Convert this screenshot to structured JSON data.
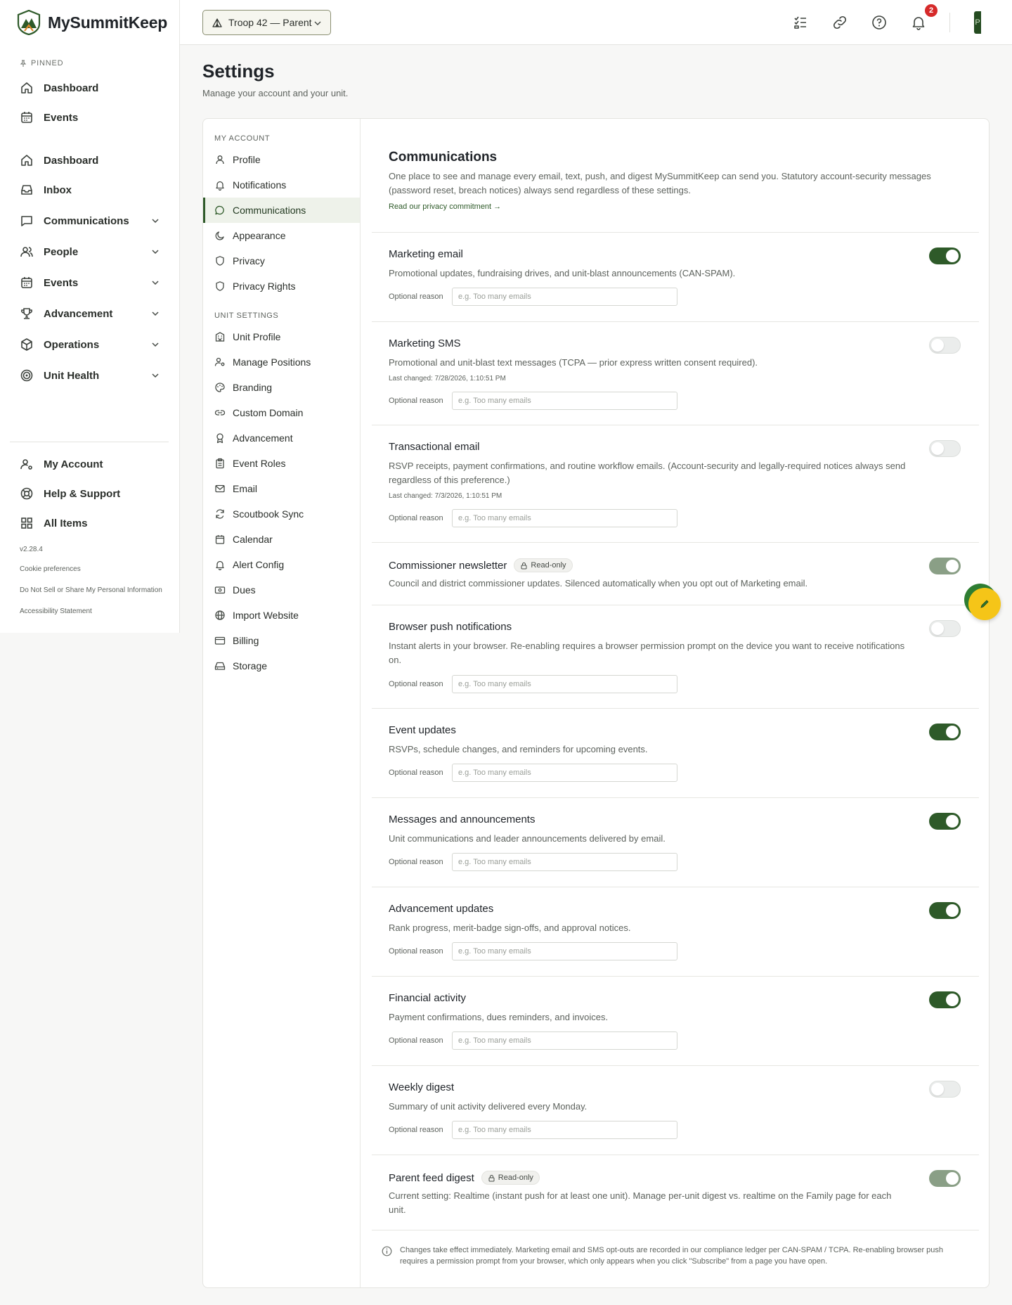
{
  "app": {
    "name": "MySummitKeep",
    "version": "v2.28.4"
  },
  "sidebar": {
    "pinned_label": "PINNED",
    "pinned": [
      {
        "label": "Dashboard"
      },
      {
        "label": "Events"
      }
    ],
    "items": [
      {
        "label": "Dashboard"
      },
      {
        "label": "Inbox"
      },
      {
        "label": "Communications"
      },
      {
        "label": "People"
      },
      {
        "label": "Events"
      },
      {
        "label": "Advancement"
      },
      {
        "label": "Operations"
      },
      {
        "label": "Unit Health"
      }
    ],
    "bottom": [
      {
        "label": "My Account"
      },
      {
        "label": "Help & Support"
      },
      {
        "label": "All Items"
      }
    ],
    "links": {
      "cookie": "Cookie preferences",
      "dns": "Do Not Sell or Share My Personal Information",
      "a11y": "Accessibility Statement"
    }
  },
  "topbar": {
    "unit_selector": "Troop 42 — Parent",
    "notification_count": "2",
    "avatar_initial": "P"
  },
  "page": {
    "title": "Settings",
    "subtitle": "Manage your account and your unit."
  },
  "settings_nav": {
    "my_account_label": "MY ACCOUNT",
    "my_account": [
      {
        "label": "Profile"
      },
      {
        "label": "Notifications"
      },
      {
        "label": "Communications"
      },
      {
        "label": "Appearance"
      },
      {
        "label": "Privacy"
      },
      {
        "label": "Privacy Rights"
      }
    ],
    "unit_settings_label": "UNIT SETTINGS",
    "unit_settings": [
      {
        "label": "Unit Profile"
      },
      {
        "label": "Manage Positions"
      },
      {
        "label": "Branding"
      },
      {
        "label": "Custom Domain"
      },
      {
        "label": "Advancement"
      },
      {
        "label": "Event Roles"
      },
      {
        "label": "Email"
      },
      {
        "label": "Scoutbook Sync"
      },
      {
        "label": "Calendar"
      },
      {
        "label": "Alert Config"
      },
      {
        "label": "Dues"
      },
      {
        "label": "Import Website"
      },
      {
        "label": "Billing"
      },
      {
        "label": "Storage"
      }
    ]
  },
  "communications": {
    "title": "Communications",
    "description": "One place to see and manage every email, text, push, and digest MySummitKeep can send you. Statutory account-security messages (password reset, breach notices) always send regardless of these settings.",
    "link": "Read our privacy commitment →",
    "reason_label": "Optional reason",
    "reason_placeholder": "e.g. Too many emails",
    "readonly_label": "Read-only",
    "preferences": [
      {
        "title": "Marketing email",
        "description": "Promotional updates, fundraising drives, and unit-blast announcements (CAN-SPAM).",
        "state": "on"
      },
      {
        "title": "Marketing SMS",
        "description": "Promotional and unit-blast text messages (TCPA — prior express written consent required).",
        "changed": "Last changed: 7/28/2026, 1:10:51 PM",
        "state": "off"
      },
      {
        "title": "Transactional email",
        "description": "RSVP receipts, payment confirmations, and routine workflow emails. (Account-security and legally-required notices always send regardless of this preference.)",
        "changed": "Last changed: 7/3/2026, 1:10:51 PM",
        "state": "off"
      },
      {
        "title": "Commissioner newsletter",
        "description": "Council and district commissioner updates. Silenced automatically when you opt out of Marketing email.",
        "state": "readonly-on"
      },
      {
        "title": "Browser push notifications",
        "description": "Instant alerts in your browser. Re-enabling requires a browser permission prompt on the device you want to receive notifications on.",
        "state": "off"
      },
      {
        "title": "Event updates",
        "description": "RSVPs, schedule changes, and reminders for upcoming events.",
        "state": "on"
      },
      {
        "title": "Messages and announcements",
        "description": "Unit communications and leader announcements delivered by email.",
        "state": "on"
      },
      {
        "title": "Advancement updates",
        "description": "Rank progress, merit-badge sign-offs, and approval notices.",
        "state": "on"
      },
      {
        "title": "Financial activity",
        "description": "Payment confirmations, dues reminders, and invoices.",
        "state": "on"
      },
      {
        "title": "Weekly digest",
        "description": "Summary of unit activity delivered every Monday.",
        "state": "off"
      },
      {
        "title": "Parent feed digest",
        "description": "Current setting: Realtime (instant push for at least one unit). Manage per-unit digest vs. realtime on the Family page for each unit.",
        "state": "readonly-on"
      }
    ],
    "footer": "Changes take effect immediately. Marketing email and SMS opt-outs are recorded in our compliance ledger per CAN-SPAM / TCPA. Re-enabling browser push requires a permission prompt from your browser, which only appears when you click \"Subscribe\" from a page you have open."
  },
  "colors": {
    "accent": "#2e5a29",
    "toggle_readonly": "#8a9f86",
    "badge": "#d62a2a",
    "fab": "#f5c518"
  },
  "icons": {
    "fab": "pencil-icon"
  }
}
